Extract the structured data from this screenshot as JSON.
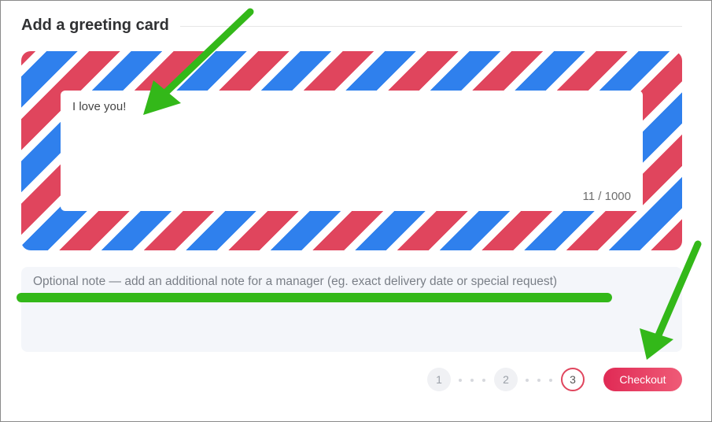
{
  "section": {
    "title": "Add a greeting card"
  },
  "greeting": {
    "message": "I love you!",
    "counter": "11 / 1000"
  },
  "note": {
    "placeholder": "Optional note — add an additional note for a manager (eg. exact delivery date or special request)"
  },
  "steps": [
    {
      "label": "1",
      "state": "inactive"
    },
    {
      "label": "2",
      "state": "inactive"
    },
    {
      "label": "3",
      "state": "active"
    }
  ],
  "checkout": {
    "label": "Checkout"
  },
  "colors": {
    "stripe_red": "#e0455d",
    "stripe_blue": "#2f80ed",
    "accent": "#e02a55",
    "annotation_green": "#33b819"
  },
  "annotations": [
    "arrow-icon",
    "arrow-icon",
    "underline"
  ]
}
